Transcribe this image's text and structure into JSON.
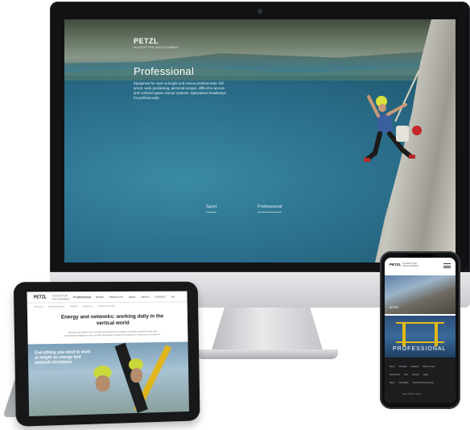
{
  "desktop": {
    "logo": "PETZL",
    "logo_sub": "ACCESS THE INACCESSIBLE",
    "heading": "Professional",
    "description": "Equipment for work at height and rescue professionals: fall arrest, work positioning, personal escape, difficult to access and confined space rescue systems. Specialized headlamps for professionals.",
    "links": [
      "Sport",
      "Professional"
    ]
  },
  "tablet": {
    "logo": "PETZL",
    "logo_sub": "ACCESS THE INACCESSIBLE",
    "brand": "Professional",
    "menu": [
      "SPORT",
      "PRODUCTS",
      "NEWS",
      "ABOUT",
      "CONTACT",
      "EN"
    ],
    "submenu": [
      "Products",
      "Technical advice",
      "Training",
      "Inspection",
      "Customer service"
    ],
    "headline": "Energy and networks: working daily in the vertical world",
    "paragraph": "Working at height in the energy and telecommunication networks requires tools and techniques adapted to the specific constraints of each environment. Discover our solutions.",
    "photo_caption": "Everything you need to work at height on energy and network structures"
  },
  "phone": {
    "logo": "PETZL",
    "logo_sub": "ACCESS THE INACCESSIBLE",
    "image1_label": "SPORT",
    "image2_label": "PROFESSIONAL",
    "footer_row1": [
      "Home",
      "Activities",
      "Products",
      "Where to buy"
    ],
    "footer_row2": [
      "About Petzl",
      "Jobs",
      "Contact",
      "Legal"
    ],
    "footer_row3": [
      "News",
      "Foundation",
      "Petzl Technical Institute"
    ],
    "footer_address": "Petzl, Crolles, France"
  }
}
